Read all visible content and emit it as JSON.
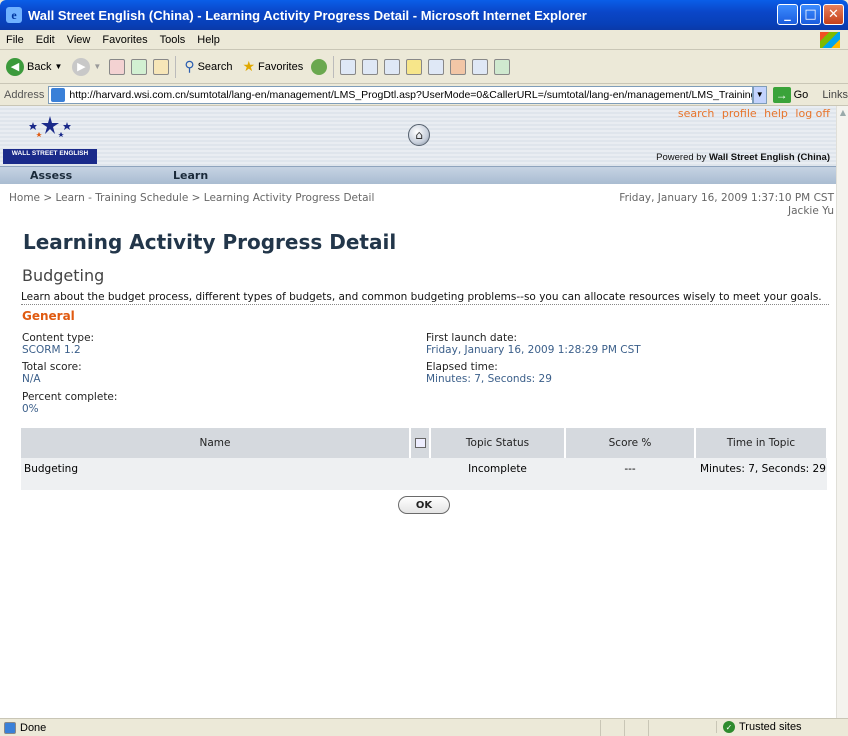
{
  "window": {
    "title": "Wall Street English (China) - Learning Activity Progress Detail - Microsoft Internet Explorer"
  },
  "menu": [
    "File",
    "Edit",
    "View",
    "Favorites",
    "Tools",
    "Help"
  ],
  "toolbar": {
    "back": "Back",
    "search": "Search",
    "favorites": "Favorites"
  },
  "address": {
    "label": "Address",
    "url": "http://harvard.wsi.com.cn/sumtotal/lang-en/management/LMS_ProgDtl.asp?UserMode=0&CallerURL=/sumtotal/lang-en/management/LMS_Training.as",
    "go": "Go",
    "links": "Links"
  },
  "header": {
    "logo_text": "WALL STREET ENGLISH",
    "links": [
      "search",
      "profile",
      "help",
      "log off"
    ],
    "powered_prefix": "Powered by ",
    "powered_brand": "Wall Street English (China)"
  },
  "nav": {
    "assess": "Assess",
    "learn": "Learn"
  },
  "breadcrumb": "Home > Learn - Training Schedule > Learning Activity Progress Detail",
  "datetime": "Friday, January 16, 2009 1:37:10 PM CST",
  "user": "Jackie Yu",
  "page_title": "Learning Activity Progress Detail",
  "activity": {
    "name": "Budgeting",
    "description": "Learn about the budget process, different types of budgets, and common budgeting problems--so you can allocate resources wisely to meet your goals."
  },
  "general": {
    "heading": "General",
    "content_type_label": "Content type:",
    "content_type_value": "SCORM 1.2",
    "total_score_label": "Total score:",
    "total_score_value": "N/A",
    "percent_label": "Percent complete:",
    "percent_value": "0%",
    "first_launch_label": "First launch date:",
    "first_launch_value": "Friday, January 16, 2009 1:28:29 PM CST",
    "elapsed_label": "Elapsed time:",
    "elapsed_value": "Minutes: 7, Seconds: 29"
  },
  "table": {
    "headers": {
      "name": "Name",
      "status": "Topic Status",
      "score": "Score %",
      "time": "Time in Topic"
    },
    "rows": [
      {
        "name": "Budgeting",
        "status": "Incomplete",
        "score": "---",
        "time": "Minutes: 7, Seconds: 29"
      }
    ]
  },
  "ok_label": "OK",
  "status": {
    "done": "Done",
    "zone": "Trusted sites"
  }
}
